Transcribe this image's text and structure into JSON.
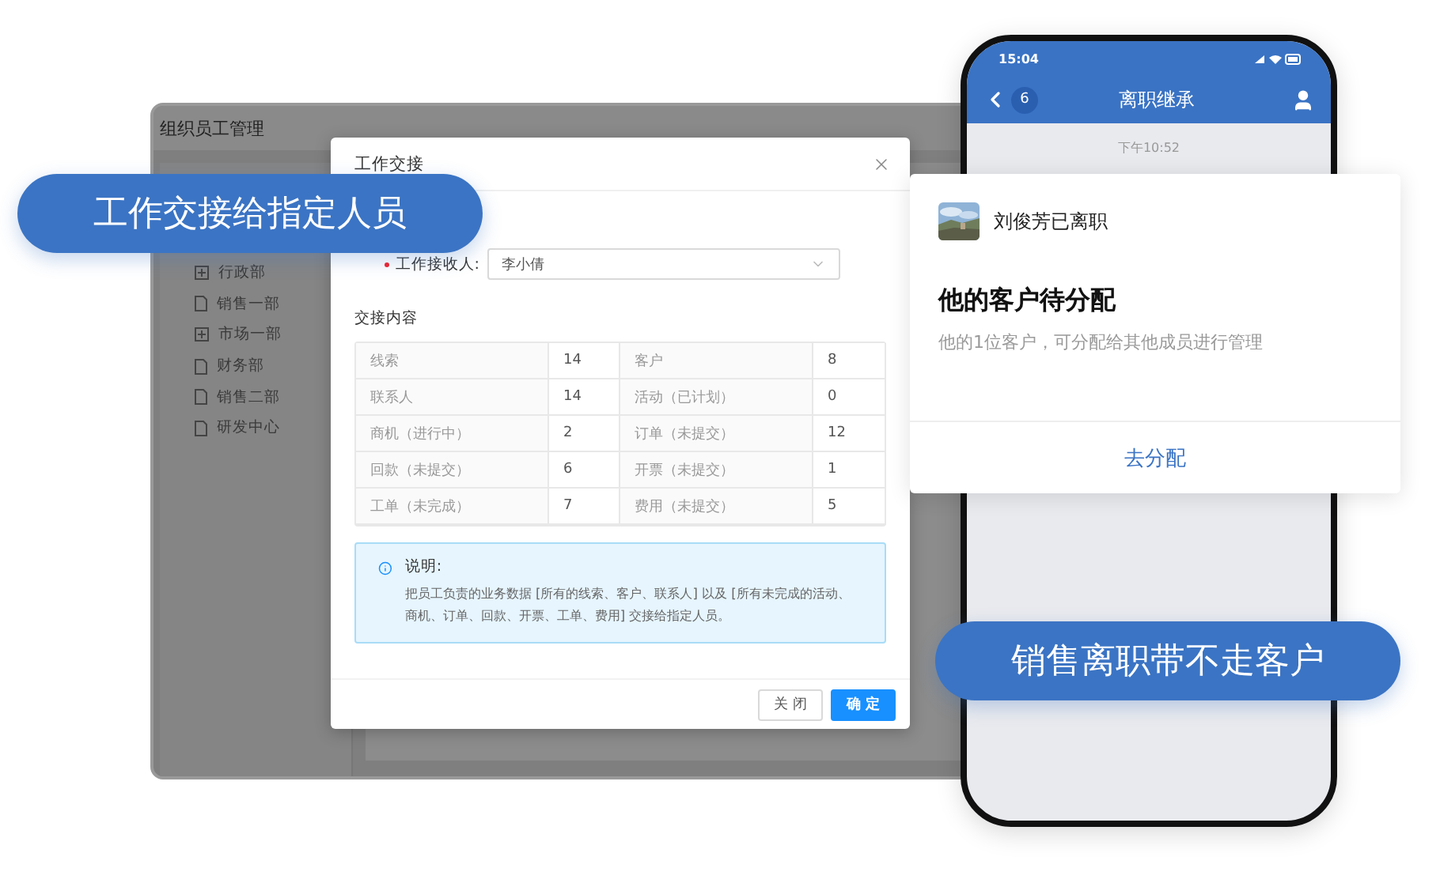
{
  "background_window": {
    "title": "组织员工管理",
    "tree": [
      {
        "label": "行政部",
        "kind": "folder"
      },
      {
        "label": "销售一部",
        "kind": "file"
      },
      {
        "label": "市场一部",
        "kind": "folder"
      },
      {
        "label": "财务部",
        "kind": "file"
      },
      {
        "label": "销售二部",
        "kind": "file"
      },
      {
        "label": "研发中心",
        "kind": "file"
      }
    ]
  },
  "dialog": {
    "title": "工作交接",
    "field": {
      "label": "工作接收人:",
      "required": true,
      "value": "李小倩"
    },
    "section_title": "交接内容",
    "rows": [
      [
        "线索",
        "14",
        "客户",
        "8"
      ],
      [
        "联系人",
        "14",
        "活动（已计划）",
        "0"
      ],
      [
        "商机（进行中）",
        "2",
        "订单（未提交）",
        "12"
      ],
      [
        "回款（未提交）",
        "6",
        "开票（未提交）",
        "1"
      ],
      [
        "工单（未完成）",
        "7",
        "费用（未提交）",
        "5"
      ]
    ],
    "notice": {
      "title": "说明:",
      "text": "把员工负责的业务数据 [所有的线索、客户、联系人] 以及 [所有未完成的活动、商机、订单、回款、开票、工单、费用] 交接给指定人员。"
    },
    "buttons": [
      {
        "label": "关闭",
        "kind": "secondary"
      },
      {
        "label": "确定",
        "kind": "primary"
      }
    ]
  },
  "phone": {
    "status_time": "15:04",
    "badge": "6",
    "title": "离职继承",
    "message_time": "下午10:52"
  },
  "card": {
    "name": "刘俊芳已离职",
    "title": "他的客户待分配",
    "subtitle": "他的1位客户，可分配给其他成员进行管理",
    "action": "去分配"
  },
  "callouts": [
    "工作交接给指定人员",
    "销售离职带不走客户"
  ]
}
